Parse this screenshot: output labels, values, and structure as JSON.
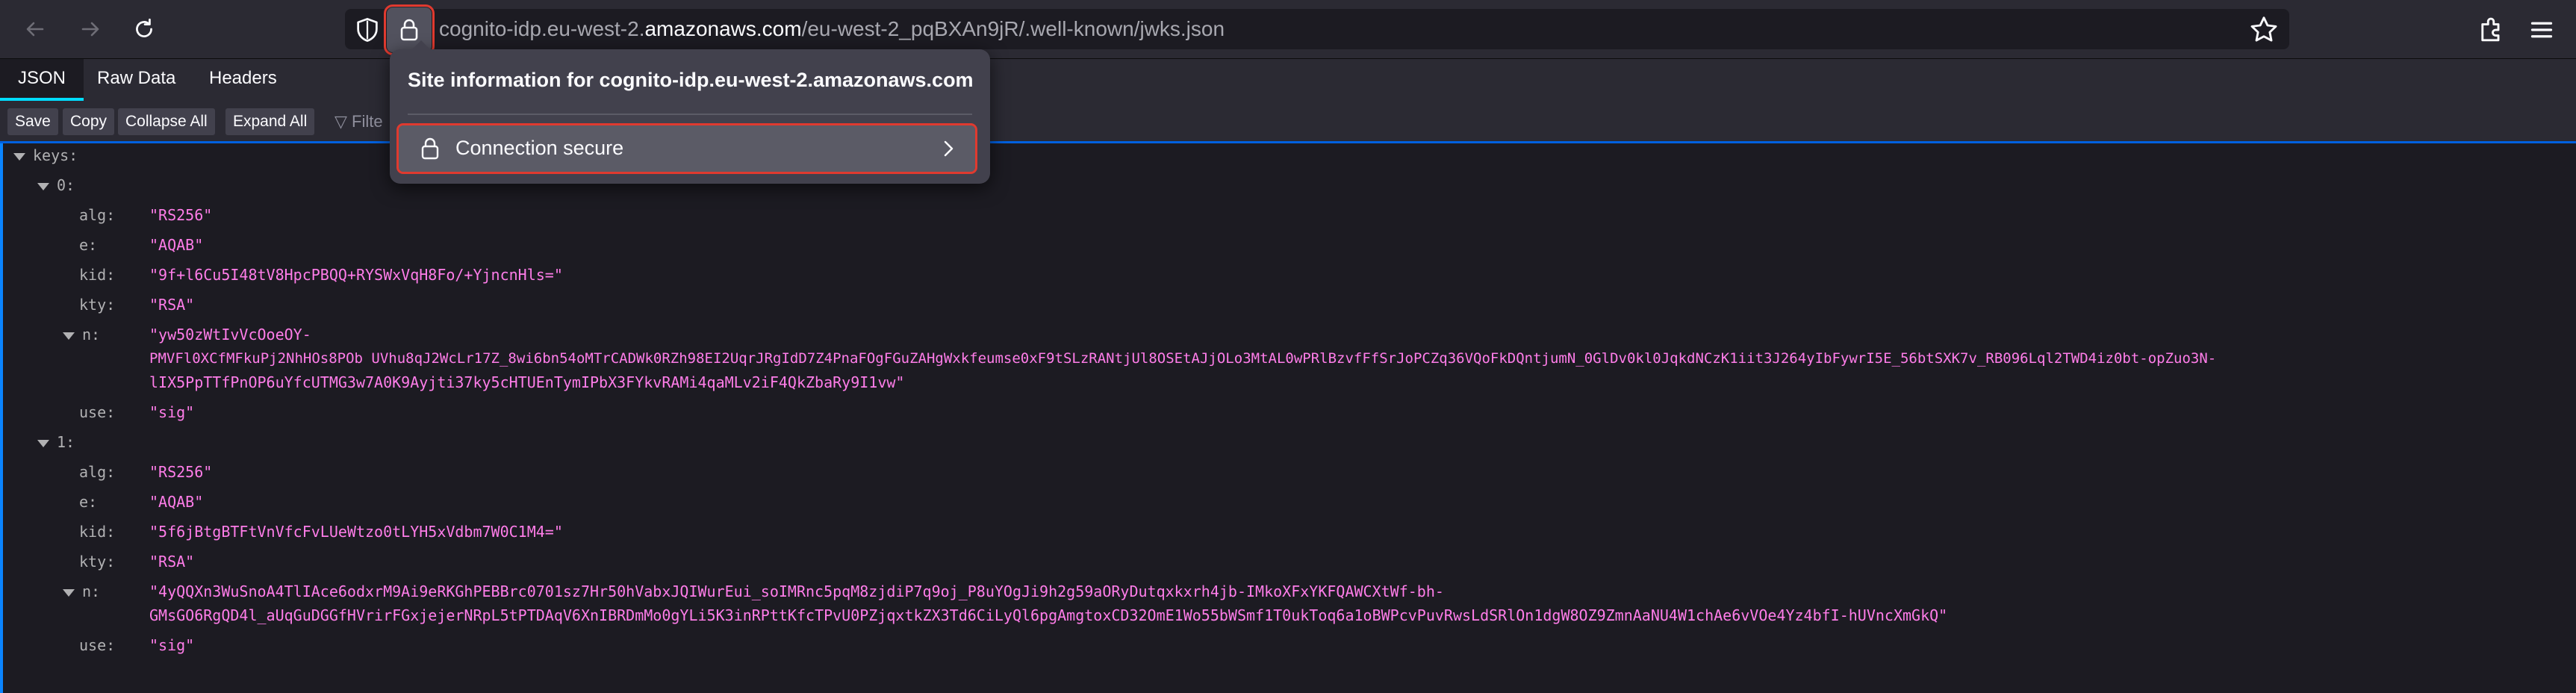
{
  "browser": {
    "url_prefix": "cognito-idp.eu-west-2.",
    "url_domain": "amazonaws.com",
    "url_path": "/eu-west-2_pqBXAn9jR/.well-known/jwks.json"
  },
  "viewer": {
    "tabs": [
      "JSON",
      "Raw Data",
      "Headers"
    ],
    "buttons": [
      "Save",
      "Copy",
      "Collapse All",
      "Expand All"
    ],
    "filter_placeholder": "Filte"
  },
  "popup": {
    "title": "Site information for cognito-idp.eu-west-2.amazonaws.com",
    "connection": "Connection secure"
  },
  "json": {
    "root_key": "keys:",
    "items": [
      {
        "index": "0:",
        "alg": "\"RS256\"",
        "e": "\"AQAB\"",
        "kid": "\"9f+l6Cu5I48tV8HpcPBQQ+RYSWxVqH8Fo/+YjncnHls=\"",
        "kty": "\"RSA\"",
        "n": [
          "\"yw50zWtIvVcOoeOY-",
          "PMVFl0XCfMFkuPj2NhHOs8POb UVhu8qJ2WcLr17Z_8wi6bn54oMTrCADWk0RZh98EI2UqrJRgIdD7Z4PnaFOgFGuZAHgWxkfeumse0xF9tSLzRANtjUl8OSEtAJjOLo3MtAL0wPRlBzvfFfSrJoPCZq36VQoFkDQntjumN_0GlDv0kl0JqkdNCzK1iit3J264yIbFywrI5E_56btSXK7v_RB096Lql2TWD4iz0bt-opZuo3N-",
          "lIX5PpTTfPnOP6uYfcUTMG3w7A0K9Ayjti37ky5cHTUEnTymIPbX3FYkvRAMi4qaMLv2iF4QkZbaRy9I1vw\""
        ],
        "use": "\"sig\""
      },
      {
        "index": "1:",
        "alg": "\"RS256\"",
        "e": "\"AQAB\"",
        "kid": "\"5f6jBtgBTFtVnVfcFvLUeWtzo0tLYH5xVdbm7W0C1M4=\"",
        "kty": "\"RSA\"",
        "n": [
          "\"4yQQXn3WuSnoA4TlIAce6odxrM9Ai9eRKGhPEBBrc0701sz7Hr50hVabxJQIWurEui_soIMRnc5pqM8zjdiP7q9oj_P8uYOgJi9h2g59aORyDutqxkxrh4jb-IMkoXFxYKFQAWCXtWf-bh-",
          "GMsGO6RgQD4l_aUqGuDGGfHVrirFGxjejerNRpL5tPTDAqV6XnIBRDmMo0gYLi5K3inRPttKfcTPvU0PZjqxtkZX3Td6CiLyQl6pgAmgtoxCD32OmE1Wo55bWSmf1T0ukToq6a1oBWPcvPuvRwsLdSRlOn1dgW8OZ9ZmnAaNU4W1chAe6vVOe4Yz4bfI-hUVncXmGkQ\""
        ],
        "use": "\"sig\""
      }
    ]
  }
}
